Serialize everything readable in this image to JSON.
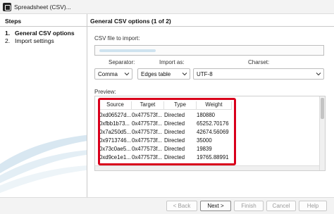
{
  "window": {
    "title": "Spreadsheet (CSV)..."
  },
  "sidebar": {
    "title": "Steps",
    "items": [
      {
        "num": "1.",
        "label": "General CSV options"
      },
      {
        "num": "2.",
        "label": "Import settings"
      }
    ]
  },
  "main": {
    "title": "General CSV options (1 of 2)",
    "file_label": "CSV file to import:",
    "file_value": "",
    "separator_label": "Separator:",
    "separator_value": "Comma",
    "import_as_label": "Import as:",
    "import_as_value": "Edges table",
    "charset_label": "Charset:",
    "charset_value": "UTF-8",
    "preview_label": "Preview:",
    "preview": {
      "columns": [
        "Source",
        "Target",
        "Type",
        "Weight"
      ],
      "rows": [
        [
          "0xd06527d...",
          "0x477573f...",
          "Directed",
          "180880"
        ],
        [
          "0xfbb1b73...",
          "0x477573f...",
          "Directed",
          "65252.70176"
        ],
        [
          "0x7a250d5...",
          "0x477573f...",
          "Directed",
          "42674.56069"
        ],
        [
          "0x9713746...",
          "0x477573f...",
          "Directed",
          "35000"
        ],
        [
          "0x73c0ae5...",
          "0x477573f...",
          "Directed",
          "19839"
        ],
        [
          "0xd9ce1e1...",
          "0x477573f...",
          "Directed",
          "19765.88991"
        ]
      ]
    }
  },
  "footer": {
    "back": "< Back",
    "next": "Next >",
    "finish": "Finish",
    "cancel": "Cancel",
    "help": "Help"
  },
  "colors": {
    "highlight": "#d9001b",
    "swoosh": "#cfe0ec"
  }
}
